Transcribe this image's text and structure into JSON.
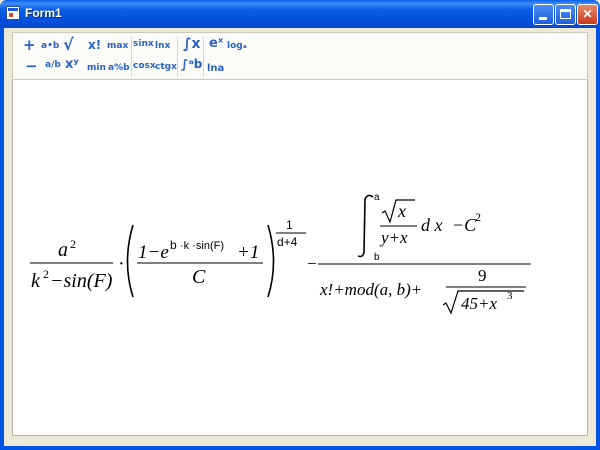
{
  "window": {
    "title": "Form1",
    "min_glyph": "",
    "close_glyph": "✕"
  },
  "toolbar": {
    "row1": [
      "+",
      "a•b",
      "√",
      "x!",
      "max",
      "sinx",
      "lnx",
      "∫x",
      "eˣ",
      "logₐ"
    ],
    "row2": [
      "−",
      "a/b",
      "xʸ",
      "min",
      "a%b",
      "cosx",
      "ctgx",
      "∫ᵃb",
      "lna"
    ]
  },
  "formula": {
    "t1_num": "a",
    "t1_num_exp": "2",
    "t1_den": "k",
    "t1_den_exp": "2",
    "t1_den_rest": "−sin(F)",
    "dot": "·",
    "in_num_1": "1−e",
    "in_exp_b": "b",
    "in_exp_k": "·k ·sin(F)",
    "in_num_2": "+1",
    "in_den": "C",
    "outer_exp_num": "1",
    "outer_exp_den": "d+4",
    "minus": "−",
    "int_upper": "a",
    "int_lower": "b",
    "int_frac_num": "x",
    "int_frac_den": "y+x",
    "dx": "d x",
    "minus_c": "−C",
    "c_exp": "2",
    "r_den_1": "x!+mod(a,  b)+",
    "r_small_num": "9",
    "r_small_den": "45+x",
    "r_small_exp": "3"
  }
}
